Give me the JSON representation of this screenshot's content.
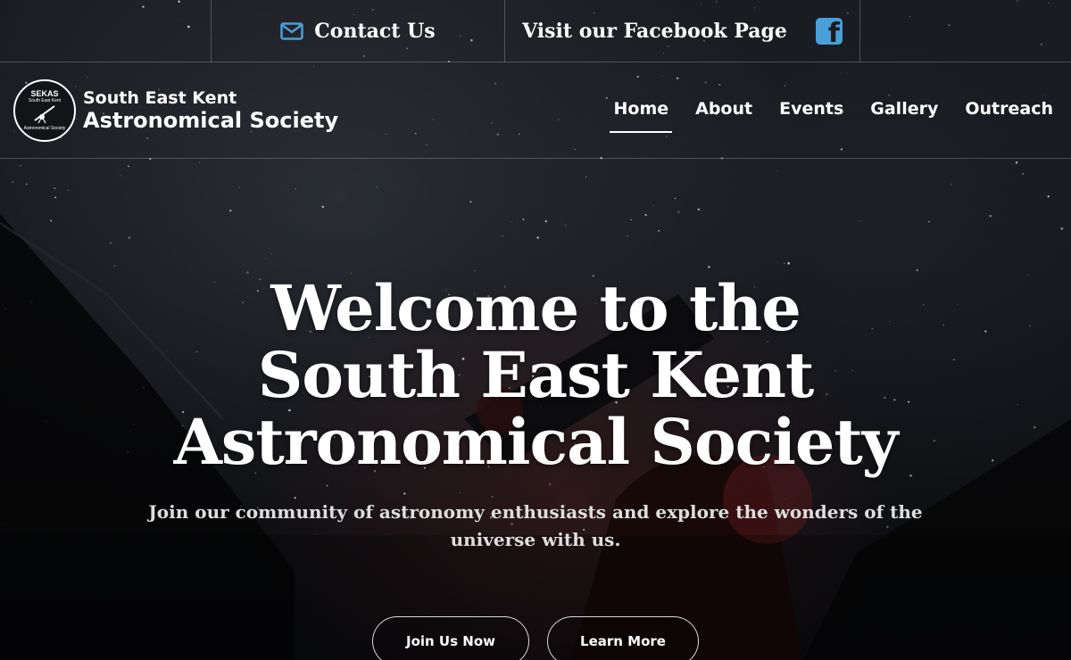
{
  "topbar": {
    "contact_label": "Contact Us",
    "facebook_label": "Visit our Facebook Page"
  },
  "logo": {
    "badge_title": "SEKAS",
    "badge_subtitle": "South East Kent",
    "badge_bottom": "Astronomical Society",
    "line1": "South East Kent",
    "line2": "Astronomical Society"
  },
  "nav": {
    "items": [
      {
        "label": "Home"
      },
      {
        "label": "About"
      },
      {
        "label": "Events"
      },
      {
        "label": "Gallery"
      },
      {
        "label": "Outreach"
      }
    ],
    "active": "Home"
  },
  "hero": {
    "title_line1": "Welcome to the",
    "title_line2": "South East Kent",
    "title_line3": "Astronomical Society",
    "subtitle": "Join our community of astronomy enthusiasts and explore the wonders of the universe with us.",
    "primary_button": "Join Us Now",
    "secondary_button": "Learn More"
  },
  "colors": {
    "accent_icon": "#4a9fd8",
    "text": "#ffffff",
    "divider": "rgba(255,255,255,0.22)"
  },
  "icons": {
    "contact": "mail-icon",
    "facebook": "facebook-icon"
  }
}
